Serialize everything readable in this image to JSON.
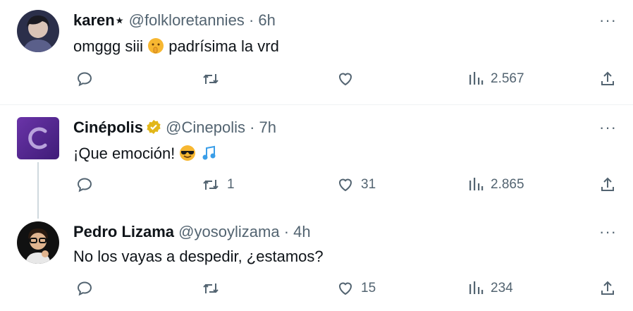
{
  "tweets": [
    {
      "name": "karen⋆",
      "handle": "@folkloretannies",
      "separator": "·",
      "time": "6h",
      "text_before": "omggg siii",
      "text_after": "padrísima la vrd",
      "emoji_1": "shushing-face",
      "more": "···",
      "replies": "",
      "retweets": "",
      "likes": "",
      "views": "2.567"
    },
    {
      "name": "Cinépolis",
      "verified": "gold-verified-badge",
      "handle": "@Cinepolis",
      "separator": "·",
      "time": "7h",
      "text_before": "¡Que emoción!",
      "emoji_1": "smiling-face-with-sunglasses",
      "emoji_2": "musical-notes",
      "more": "···",
      "replies": "",
      "retweets": "1",
      "likes": "31",
      "views": "2.865"
    },
    {
      "name": "Pedro Lizama",
      "handle": "@yosoylizama",
      "separator": "·",
      "time": "4h",
      "text_before": "No los vayas a despedir, ¿estamos?",
      "more": "···",
      "replies": "",
      "retweets": "",
      "likes": "15",
      "views": "234"
    }
  ],
  "colors": {
    "text": "#0f1419",
    "secondary": "#536471",
    "brand_purple": "#5b2a91",
    "verified_gold": "#e2b719"
  }
}
